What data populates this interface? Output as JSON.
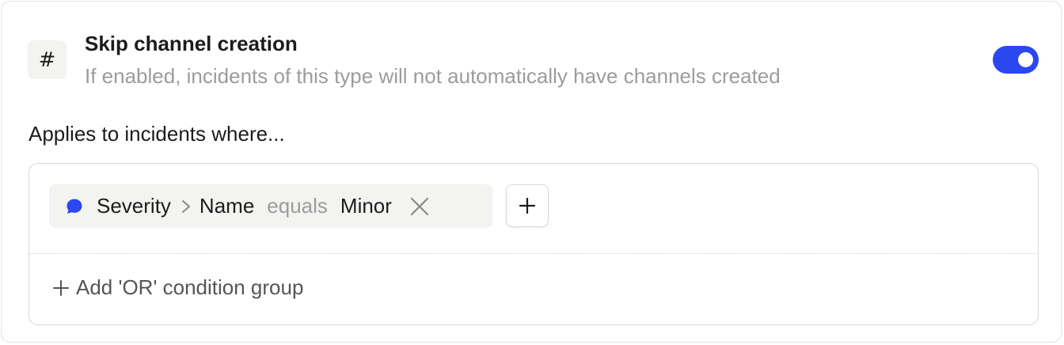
{
  "setting": {
    "icon": "hash-icon",
    "icon_glyph": "#",
    "title": "Skip channel creation",
    "description": "If enabled, incidents of this type will not automatically have channels created",
    "toggle_on": true,
    "toggle_color": "#2b47f0"
  },
  "conditions": {
    "heading": "Applies to incidents where...",
    "items": [
      {
        "icon": "speech-bubble-icon",
        "field": "Severity",
        "subfield": "Name",
        "operator": "equals",
        "value": "Minor"
      }
    ],
    "add_or_group_label": "Add 'OR' condition group"
  },
  "colors": {
    "accent": "#2b47f0",
    "text_primary": "#1c1c1c",
    "text_muted": "#9c9c9c",
    "chip_bg": "#f3f3f2"
  }
}
